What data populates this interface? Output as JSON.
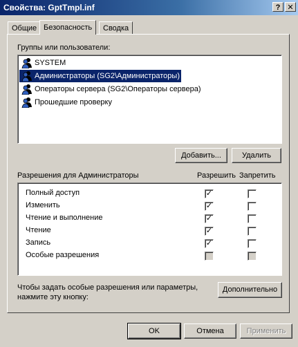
{
  "window": {
    "title": "Свойства: GptTmpl.inf",
    "help_button": "?",
    "close_button": "✕"
  },
  "tabs": [
    {
      "label": "Общие",
      "active": false
    },
    {
      "label": "Безопасность",
      "active": true
    },
    {
      "label": "Сводка",
      "active": false
    }
  ],
  "groups": {
    "label": "Группы или пользователи:",
    "items": [
      {
        "label": "SYSTEM",
        "icon": "users-group-icon",
        "selected": false
      },
      {
        "label": "Администраторы (SG2\\Администраторы)",
        "icon": "users-group-icon",
        "selected": true
      },
      {
        "label": "Операторы сервера (SG2\\Операторы сервера)",
        "icon": "users-group-icon",
        "selected": false
      },
      {
        "label": "Прошедшие проверку",
        "icon": "users-group-icon",
        "selected": false
      }
    ],
    "add_button": "Добавить...",
    "remove_button": "Удалить"
  },
  "permissions": {
    "title": "Разрешения для Администраторы",
    "allow_header": "Разрешить",
    "deny_header": "Запретить",
    "rows": [
      {
        "label": "Полный доступ",
        "allow": true,
        "deny": false,
        "disabled": false
      },
      {
        "label": "Изменить",
        "allow": true,
        "deny": false,
        "disabled": false
      },
      {
        "label": "Чтение и выполнение",
        "allow": true,
        "deny": false,
        "disabled": false
      },
      {
        "label": "Чтение",
        "allow": true,
        "deny": false,
        "disabled": false
      },
      {
        "label": "Запись",
        "allow": true,
        "deny": false,
        "disabled": false
      },
      {
        "label": "Особые разрешения",
        "allow": false,
        "deny": false,
        "disabled": true
      }
    ]
  },
  "advanced": {
    "hint": "Чтобы задать особые разрешения или параметры, нажмите эту кнопку:",
    "button": "Дополнительно"
  },
  "footer": {
    "ok": "OK",
    "cancel": "Отмена",
    "apply": "Применить"
  },
  "colors": {
    "titlebar": "#0a246a",
    "face": "#d4d0c8",
    "selection": "#0a246a"
  }
}
